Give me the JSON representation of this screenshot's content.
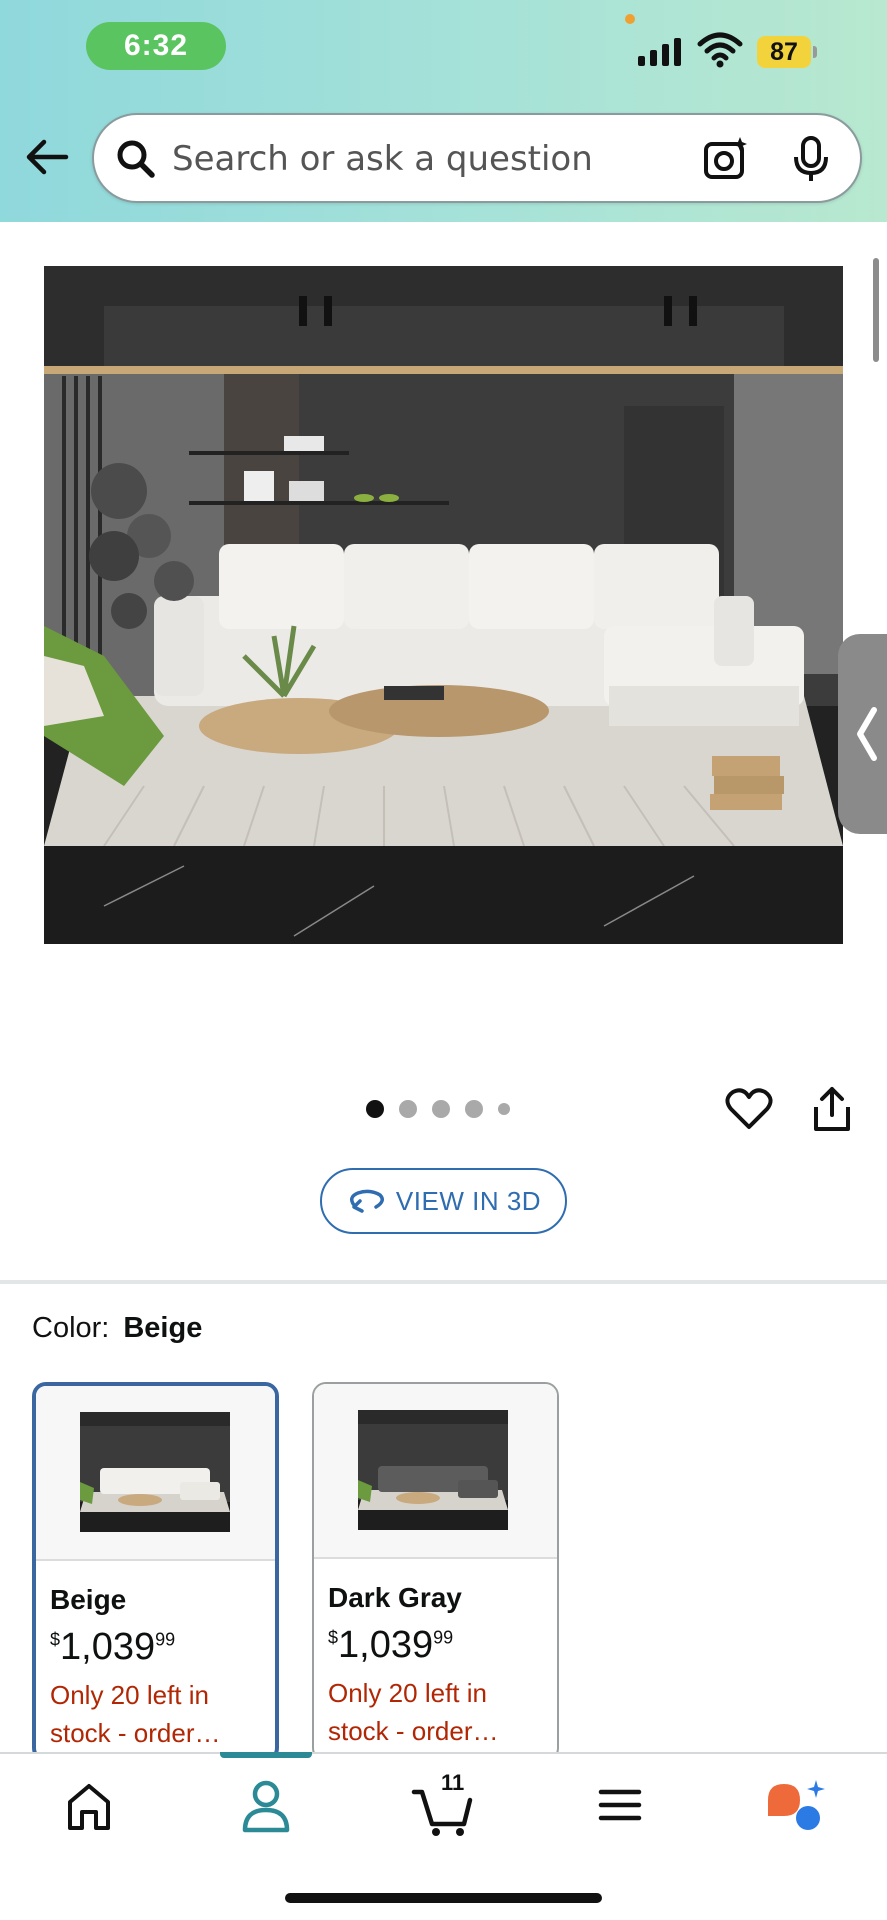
{
  "status_bar": {
    "time": "6:32",
    "battery": "87"
  },
  "search": {
    "placeholder": "Search or ask a question"
  },
  "gallery": {
    "page_count": 5,
    "active_page": 1
  },
  "view3d": {
    "label": "VIEW IN 3D"
  },
  "color": {
    "label": "Color:",
    "selected": "Beige"
  },
  "swatches": [
    {
      "name": "Beige",
      "currency": "$",
      "price_whole": "1,039",
      "price_fraction": "99",
      "stock": "Only 20 left in stock - order…",
      "selected": true
    },
    {
      "name": "Dark Gray",
      "currency": "$",
      "price_whole": "1,039",
      "price_fraction": "99",
      "stock": "Only 20 left in stock - order…",
      "selected": false
    }
  ],
  "nav": {
    "items": [
      "home-icon",
      "account-icon",
      "cart-icon",
      "menu-icon",
      "rufus-assistant-icon"
    ],
    "active": "account-icon",
    "cart_count": "11"
  },
  "colors": {
    "accent_blue": "#2f6db0",
    "stock_red": "#b12704",
    "nav_active": "#2b8a96",
    "header_gradient_start": "#8fd8dc"
  }
}
